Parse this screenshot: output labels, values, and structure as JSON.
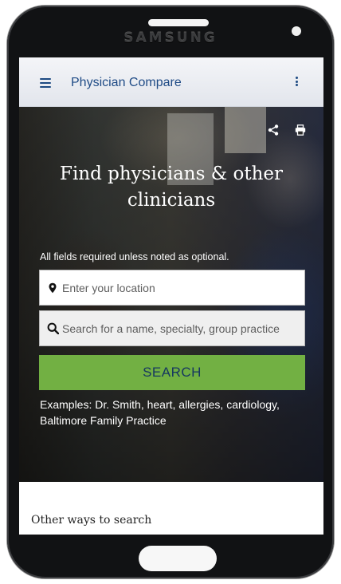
{
  "device": {
    "brand": "SAMSUNG"
  },
  "header": {
    "title": "Physician Compare",
    "menu_icon": "hamburger-menu-icon",
    "more_icon": "vertical-dots-icon"
  },
  "hero": {
    "share_icon": "share-icon",
    "print_icon": "print-icon",
    "title": "Find physicians & other clinicians",
    "required_note": "All fields required unless noted as optional.",
    "location": {
      "placeholder": "Enter your location",
      "value": ""
    },
    "query": {
      "placeholder": "Search for a name, specialty, group practice",
      "value": ""
    },
    "search_label": "SEARCH",
    "examples": "Examples: Dr. Smith, heart, allergies, cardiology, Baltimore Family Practice"
  },
  "section": {
    "other_ways": "Other ways to search"
  },
  "colors": {
    "accent": "#72b043",
    "header_text": "#1f4b86",
    "button_text": "#163760"
  }
}
